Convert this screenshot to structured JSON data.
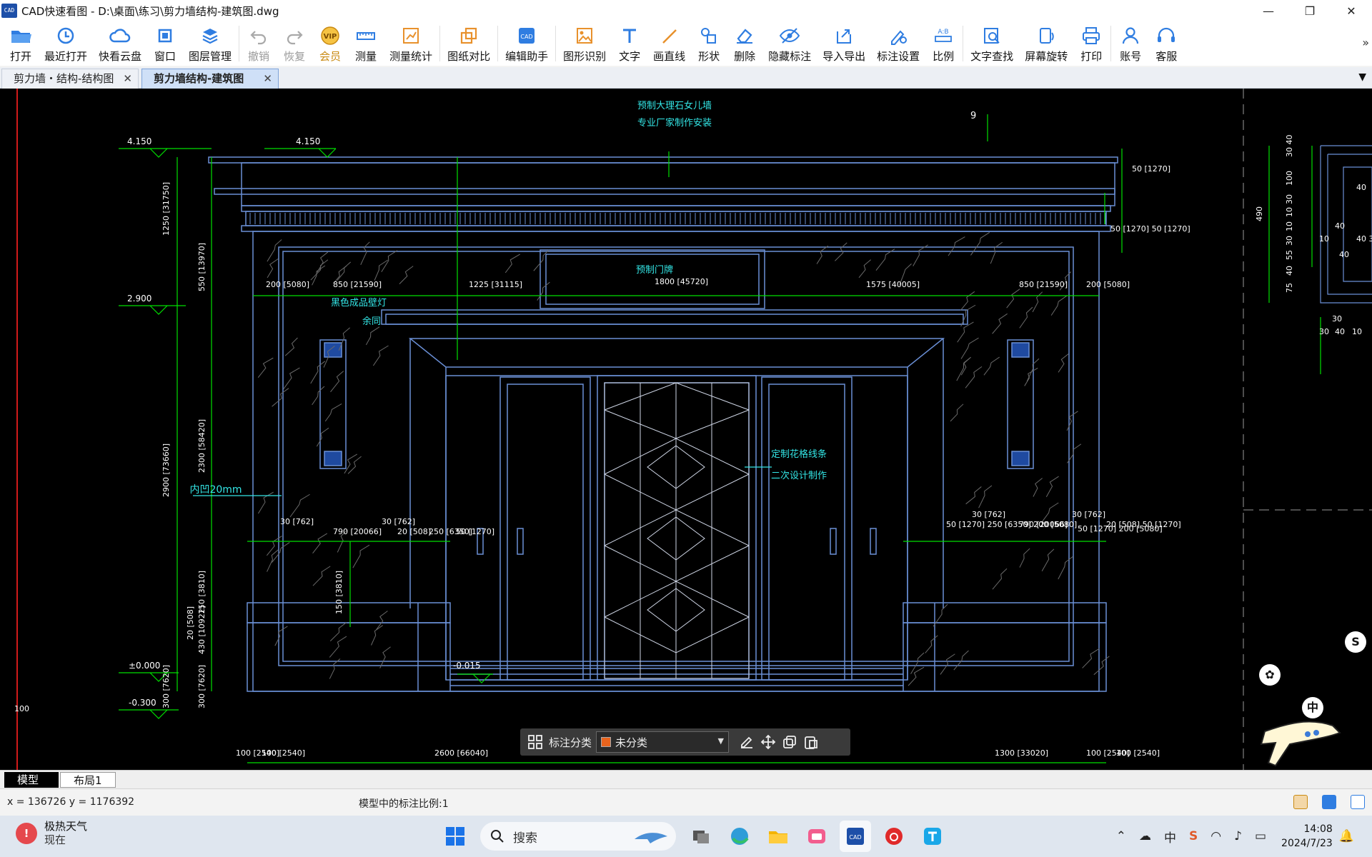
{
  "window": {
    "title": "CAD快速看图 - D:\\桌面\\练习\\剪力墙结构-建筑图.dwg",
    "app_icon_text": "CAD",
    "controls": {
      "minimize": "—",
      "maximize": "❐",
      "close": "✕"
    }
  },
  "toolbar": {
    "items": [
      {
        "label": "打开",
        "icon": "folder-open-icon"
      },
      {
        "label": "最近打开",
        "icon": "clock-icon"
      },
      {
        "label": "快看云盘",
        "icon": "cloud-icon"
      },
      {
        "label": "窗口",
        "icon": "window-icon"
      },
      {
        "label": "图层管理",
        "icon": "layers-icon"
      },
      {
        "label": "撤销",
        "icon": "undo-icon"
      },
      {
        "label": "恢复",
        "icon": "redo-icon"
      },
      {
        "label": "会员",
        "icon": "vip-icon"
      },
      {
        "label": "测量",
        "icon": "ruler-icon"
      },
      {
        "label": "测量统计",
        "icon": "measure-stats-icon"
      },
      {
        "label": "图纸对比",
        "icon": "compare-icon"
      },
      {
        "label": "编辑助手",
        "icon": "edit-assistant-icon"
      },
      {
        "label": "图形识别",
        "icon": "shape-recognize-icon"
      },
      {
        "label": "文字",
        "icon": "text-icon"
      },
      {
        "label": "画直线",
        "icon": "line-icon"
      },
      {
        "label": "形状",
        "icon": "shape-icon"
      },
      {
        "label": "删除",
        "icon": "eraser-icon"
      },
      {
        "label": "隐藏标注",
        "icon": "eye-hide-icon"
      },
      {
        "label": "导入导出",
        "icon": "import-export-icon"
      },
      {
        "label": "标注设置",
        "icon": "annotation-settings-icon"
      },
      {
        "label": "比例",
        "icon": "scale-icon"
      },
      {
        "label": "文字查找",
        "icon": "text-search-icon"
      },
      {
        "label": "屏幕旋转",
        "icon": "rotate-screen-icon"
      },
      {
        "label": "打印",
        "icon": "printer-icon"
      },
      {
        "label": "账号",
        "icon": "account-icon"
      },
      {
        "label": "客服",
        "icon": "headset-icon"
      }
    ],
    "more": "»",
    "accent": "#2f7de1",
    "vip_color": "#c98a12",
    "disabled_color": "#9a9a9a"
  },
  "doc_tabs": [
    {
      "label": "剪力墙・结构-结构图",
      "active": false
    },
    {
      "label": "剪力墙结构-建筑图",
      "active": true
    }
  ],
  "tab_dropdown": "▼",
  "drawing": {
    "texts": [
      {
        "t": "预制大理石女儿墙",
        "c": "cyan"
      },
      {
        "t": "专业厂家制作安装",
        "c": "cyan"
      },
      {
        "t": "预制门牌",
        "c": "cyan"
      },
      {
        "t": "1800 [45720]",
        "c": "white"
      },
      {
        "t": "黑色成品壁灯",
        "c": "cyan"
      },
      {
        "t": "余同",
        "c": "cyan"
      },
      {
        "t": "定制花格线条",
        "c": "cyan"
      },
      {
        "t": "二次设计制作",
        "c": "cyan"
      },
      {
        "t": "内凹20mm",
        "c": "cyan"
      },
      {
        "t": "4.150",
        "c": "white"
      },
      {
        "t": "4.150",
        "c": "white"
      },
      {
        "t": "2.900",
        "c": "white"
      },
      {
        "t": "±0.000",
        "c": "white"
      },
      {
        "t": "-0.300",
        "c": "white"
      },
      {
        "t": "-0.015",
        "c": "white"
      },
      {
        "t": "200 [5080]",
        "c": "white"
      },
      {
        "t": "850 [21590]",
        "c": "white"
      },
      {
        "t": "1225 [31115]",
        "c": "white"
      },
      {
        "t": "1575 [40005]",
        "c": "white"
      },
      {
        "t": "850 [21590]",
        "c": "white"
      },
      {
        "t": "200 [5080]",
        "c": "white"
      },
      {
        "t": "50 [1270]",
        "c": "white"
      },
      {
        "t": "50 [1270] 50 [1270]",
        "c": "white"
      },
      {
        "t": "50 [1270] 200 [5080]",
        "c": "white"
      },
      {
        "t": "790 [20066]",
        "c": "white"
      },
      {
        "t": "30 [762]",
        "c": "white"
      },
      {
        "t": "30 [762]",
        "c": "white"
      },
      {
        "t": "20 [508]",
        "c": "white"
      },
      {
        "t": "250 [6350]",
        "c": "white"
      },
      {
        "t": "50 [1270]",
        "c": "white"
      },
      {
        "t": "50 [1270] 250 [6350] 200 [5080]",
        "c": "white"
      },
      {
        "t": "790 [20066]",
        "c": "white"
      },
      {
        "t": "30 [762]",
        "c": "white"
      },
      {
        "t": "30 [762]",
        "c": "white"
      },
      {
        "t": "20 [508] 50 [1270]",
        "c": "white"
      },
      {
        "t": "100 [2540]",
        "c": "white"
      },
      {
        "t": "100 [2540]",
        "c": "white"
      },
      {
        "t": "2600 [66040]",
        "c": "white"
      },
      {
        "t": "1300 [33020]",
        "c": "white"
      },
      {
        "t": "100 [2540]",
        "c": "white"
      },
      {
        "t": "100 [2540]",
        "c": "white"
      },
      {
        "t": "1250 [31750]",
        "c": "white"
      },
      {
        "t": "550 [13970]",
        "c": "white"
      },
      {
        "t": "2900 [73660]",
        "c": "white"
      },
      {
        "t": "2300 [58420]",
        "c": "white"
      },
      {
        "t": "150 [3810]",
        "c": "white"
      },
      {
        "t": "20 [508]",
        "c": "white"
      },
      {
        "t": "430 [10922]",
        "c": "white"
      },
      {
        "t": "300 [7620]",
        "c": "white"
      },
      {
        "t": "300 [7620]",
        "c": "white"
      },
      {
        "t": "150 [3810]",
        "c": "white"
      },
      {
        "t": "9",
        "c": "white"
      },
      {
        "t": "490",
        "c": "white"
      },
      {
        "t": "30 40",
        "c": "white"
      },
      {
        "t": "100",
        "c": "white"
      },
      {
        "t": "30",
        "c": "white"
      },
      {
        "t": "10",
        "c": "white"
      },
      {
        "t": "10",
        "c": "white"
      },
      {
        "t": "30",
        "c": "white"
      },
      {
        "t": "55",
        "c": "white"
      },
      {
        "t": "40",
        "c": "white"
      },
      {
        "t": "75",
        "c": "white"
      },
      {
        "t": "40",
        "c": "white"
      },
      {
        "t": "40",
        "c": "white"
      },
      {
        "t": "10",
        "c": "white"
      },
      {
        "t": "40 30",
        "c": "white"
      },
      {
        "t": "40",
        "c": "white"
      },
      {
        "t": "30",
        "c": "white"
      },
      {
        "t": "30",
        "c": "white"
      },
      {
        "t": "40",
        "c": "white"
      },
      {
        "t": "10",
        "c": "white"
      },
      {
        "t": "100",
        "c": "white"
      }
    ],
    "colors": {
      "background": "#000000",
      "dim": "#00e000",
      "outline": "#6a8fd6",
      "annot": "#33e6e6",
      "text": "#ffffff",
      "red_axis": "#d11a1a"
    }
  },
  "floatbar": {
    "label": "标注分类",
    "selected": "未分类",
    "swatch": "#e8641e"
  },
  "layout_tabs": [
    {
      "label": "模型",
      "active": true
    },
    {
      "label": "布局1",
      "active": false
    }
  ],
  "status": {
    "coords": "x = 136726  y = 1176392",
    "scale_text": "模型中的标注比例:1"
  },
  "taskbar": {
    "weather_badge": "!",
    "weather_title": "极热天气",
    "weather_sub": "现在",
    "search_placeholder": "搜索",
    "tray_lang": "中",
    "time": "14:08",
    "date": "2024/7/23"
  }
}
